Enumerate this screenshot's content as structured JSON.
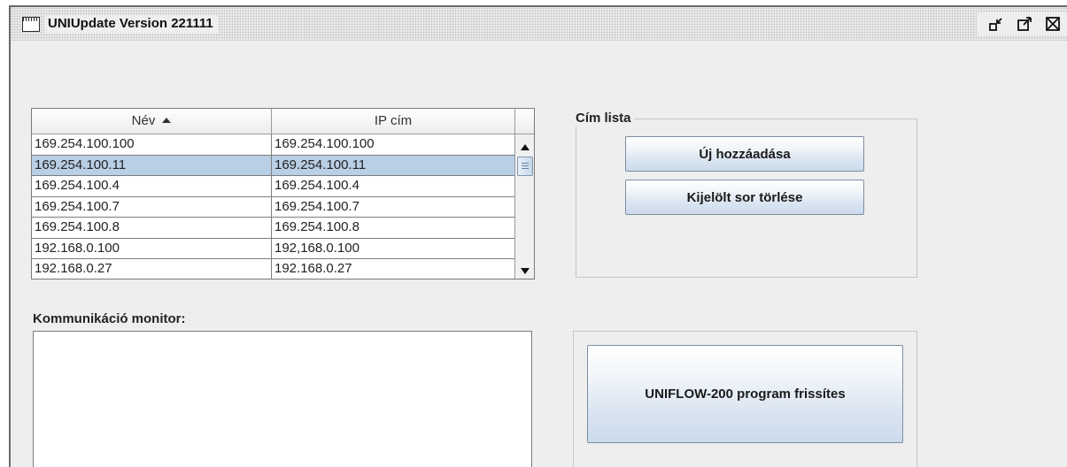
{
  "window": {
    "title": "UNIUpdate Version 221111",
    "buttons": [
      {
        "name": "minimize",
        "icon": "minimize-icon"
      },
      {
        "name": "maximize",
        "icon": "maximize-icon"
      },
      {
        "name": "close",
        "icon": "close-icon"
      }
    ]
  },
  "address_table": {
    "columns": [
      "Név",
      "IP cím"
    ],
    "sort_column": "Név",
    "sort_direction": "ascending",
    "selected_row": 1,
    "rows": [
      [
        "169.254.100.100",
        "169.254.100.100"
      ],
      [
        "169.254.100.11",
        "169.254.100.11"
      ],
      [
        "169.254.100.4",
        "169.254.100.4"
      ],
      [
        "169.254.100.7",
        "169.254.100.7"
      ],
      [
        "169.254.100.8",
        "169.254.100.8"
      ],
      [
        "192.168.0.100",
        "192,168.0.100"
      ],
      [
        "192.168.0.27",
        "192.168.0.27"
      ]
    ]
  },
  "address_list": {
    "title": "Cím lista",
    "add_label": "Új hozzáadása",
    "delete_label": "Kijelölt sor törlése"
  },
  "monitor": {
    "label": "Kommunikáció monitor:",
    "content": ""
  },
  "update": {
    "button_label": "UNIFLOW-200 program frissítes"
  },
  "colors": {
    "window_bg": "#eeeeee",
    "selected_row": "#b8cfe5",
    "button_gradient_bottom": "#cbdaec",
    "button_border": "#7d8ea3"
  }
}
